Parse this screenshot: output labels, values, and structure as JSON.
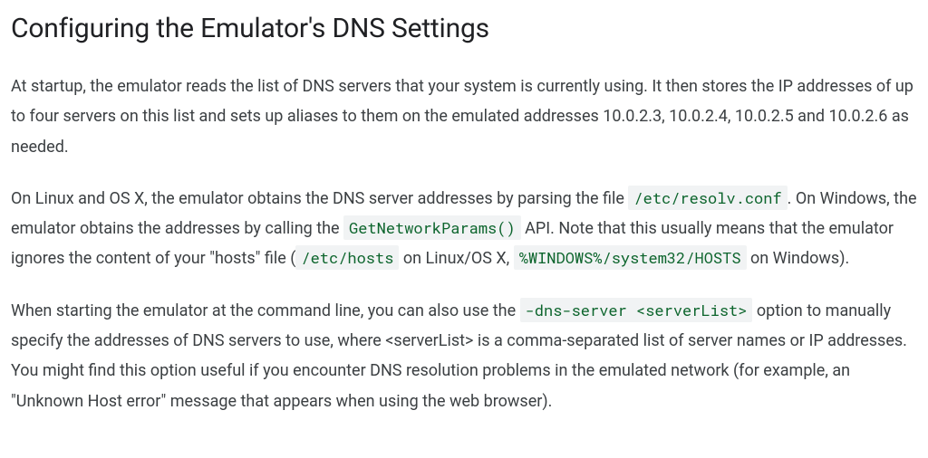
{
  "heading": "Configuring the Emulator's DNS Settings",
  "para1": "At startup, the emulator reads the list of DNS servers that your system is currently using. It then stores the IP addresses of up to four servers on this list and sets up aliases to them on the emulated addresses 10.0.2.3, 10.0.2.4, 10.0.2.5 and 10.0.2.6 as needed.",
  "para2": {
    "t1": "On Linux and OS X, the emulator obtains the DNS server addresses by parsing the file ",
    "c1": "/etc/resolv.conf",
    "t2": ". On Windows, the emulator obtains the addresses by calling the ",
    "c2": "GetNetworkParams()",
    "t3": " API. Note that this usually means that the emulator ignores the content of your \"hosts\" file (",
    "c3": "/etc/hosts",
    "t4": " on Linux/OS X, ",
    "c4": "%WINDOWS%/system32/HOSTS",
    "t5": " on Windows)."
  },
  "para3": {
    "t1": "When starting the emulator at the command line, you can also use the ",
    "c1": "-dns-server <serverList>",
    "t2": " option to manually specify the addresses of DNS servers to use, where <serverList> is a comma-separated list of server names or IP addresses. You might find this option useful if you encounter DNS resolution problems in the emulated network (for example, an \"Unknown Host error\" message that appears when using the web browser)."
  }
}
